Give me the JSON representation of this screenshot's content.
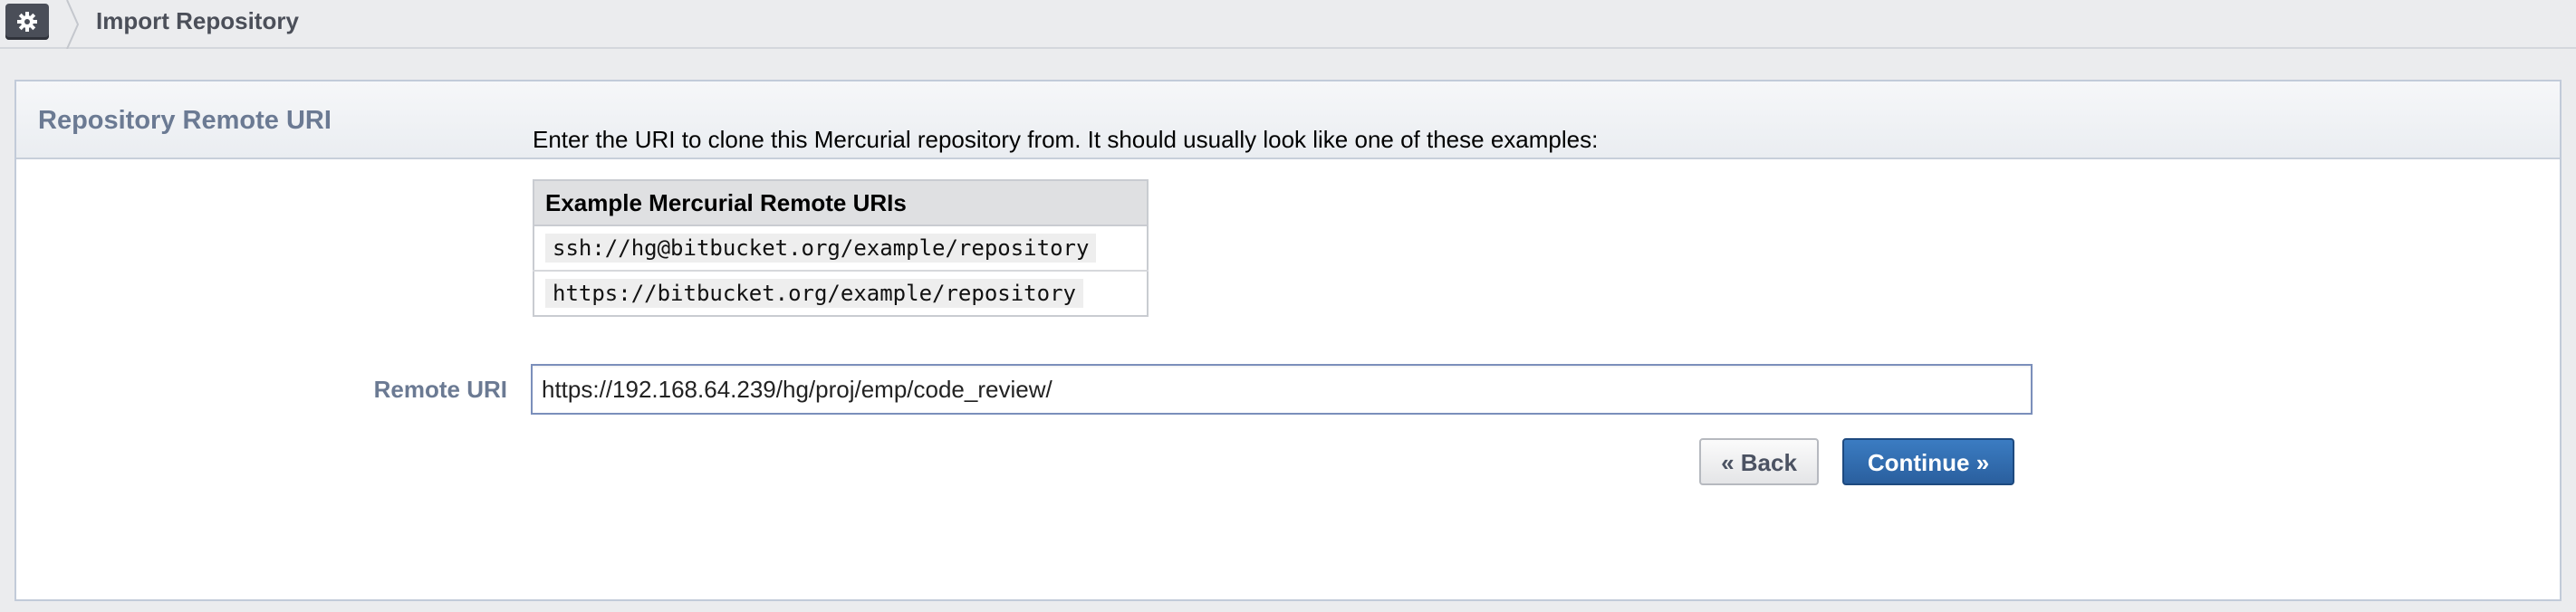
{
  "crumbbar": {
    "app_icon": "gear-icon",
    "title": "Import Repository"
  },
  "panel": {
    "title": "Repository Remote URI",
    "instructions": "Enter the URI to clone this Mercurial repository from. It should usually look like one of these examples:",
    "examples": {
      "header": "Example Mercurial Remote URIs",
      "rows": [
        "ssh://hg@bitbucket.org/example/repository",
        "https://bitbucket.org/example/repository"
      ]
    },
    "form": {
      "remote_uri_label": "Remote URI",
      "remote_uri_value": "https://192.168.64.239/hg/proj/emp/code_review/"
    },
    "buttons": {
      "back_label": "« Back",
      "continue_label": "Continue »"
    }
  },
  "colors": {
    "accent": "#2a5f9e",
    "label": "#6b7a93",
    "input_border": "#7b8fbb"
  }
}
